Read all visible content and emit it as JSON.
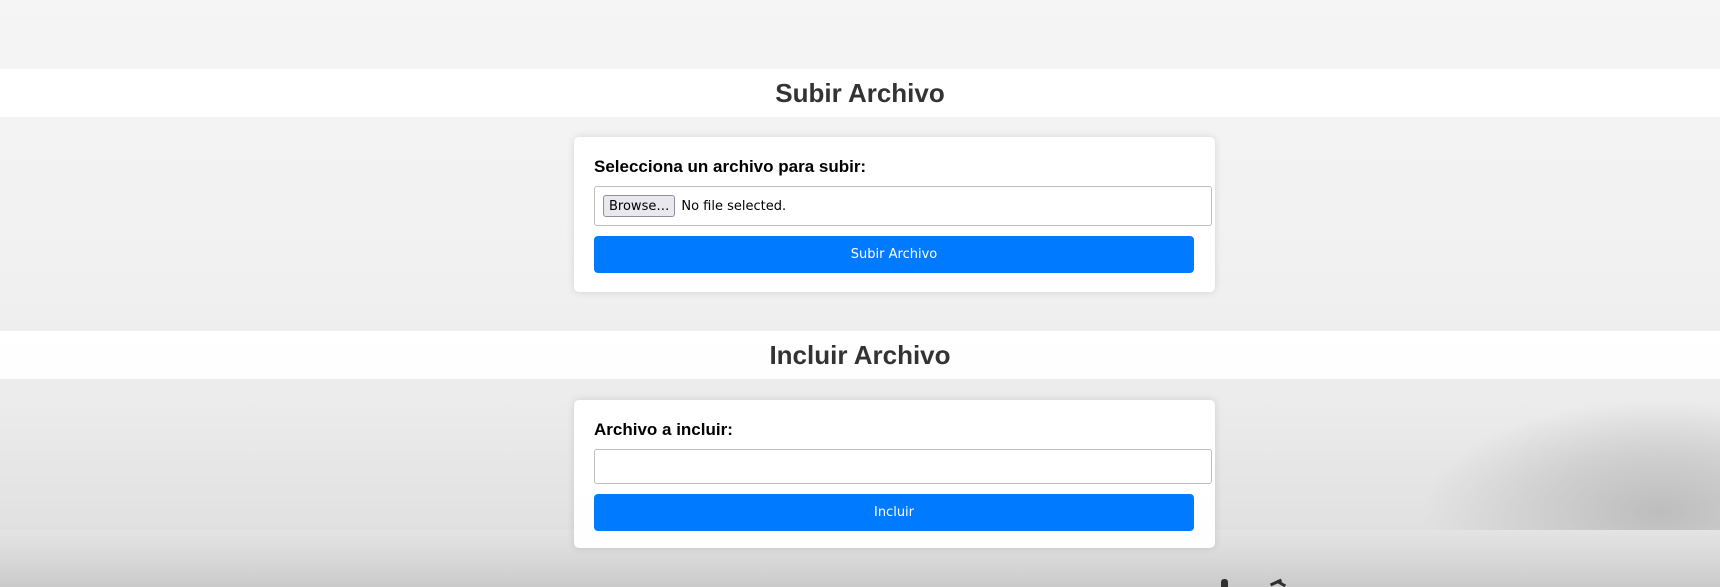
{
  "upload_section": {
    "title": "Subir Archivo",
    "label": "Selecciona un archivo para subir:",
    "browse_label": "Browse…",
    "file_status": "No file selected.",
    "submit_label": "Subir Archivo"
  },
  "include_section": {
    "title": "Incluir Archivo",
    "label": "Archivo a incluir:",
    "input_value": "",
    "submit_label": "Incluir"
  },
  "colors": {
    "button_primary": "#007bff",
    "heading_text": "#333333"
  }
}
